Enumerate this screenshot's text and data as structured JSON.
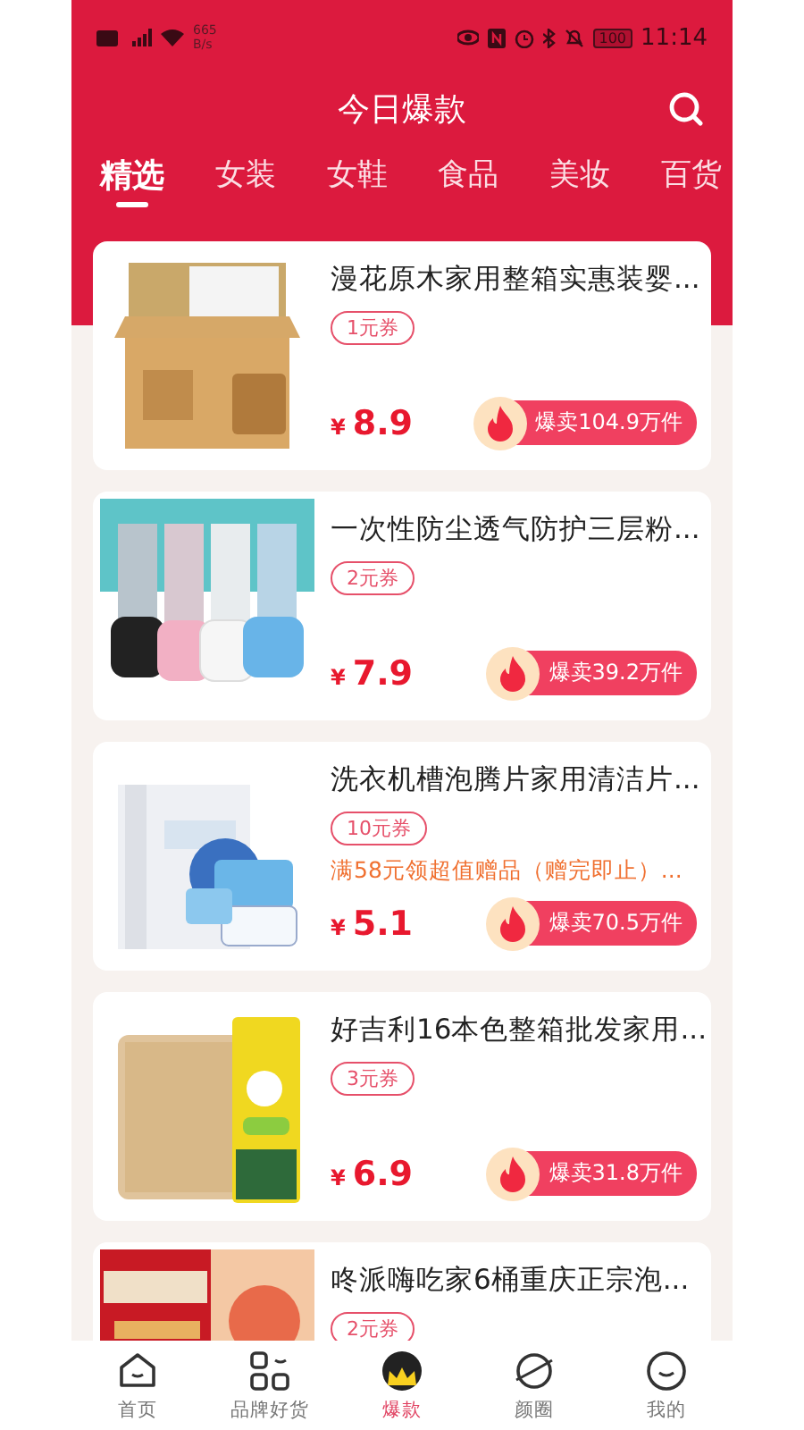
{
  "status_bar": {
    "network_speed": "665 B/s",
    "battery": "100",
    "time": "11:14"
  },
  "header": {
    "title": "今日爆款"
  },
  "tabs": [
    {
      "label": "精选",
      "selected": true
    },
    {
      "label": "女装",
      "selected": false
    },
    {
      "label": "女鞋",
      "selected": false
    },
    {
      "label": "食品",
      "selected": false
    },
    {
      "label": "美妆",
      "selected": false
    },
    {
      "label": "百货",
      "selected": false
    }
  ],
  "products": [
    {
      "kind": "picture",
      "title": "漫花原木家用整箱实惠装婴...",
      "coupon": "1元券",
      "currency": "¥",
      "price": "8.9",
      "sales": "爆卖104.9万件"
    },
    {
      "kind": "picture",
      "title": "一次性防尘透气防护三层粉...",
      "coupon": "2元券",
      "currency": "¥",
      "price": "7.9",
      "sales": "爆卖39.2万件"
    },
    {
      "kind": "picture",
      "title": "洗衣机槽泡腾片家用清洁片...",
      "coupon": "10元券",
      "promo": "满58元领超值赠品（赠完即止）...",
      "currency": "¥",
      "price": "5.1",
      "sales": "爆卖70.5万件"
    },
    {
      "kind": "picture",
      "title": "好吉利16本色整箱批发家用...",
      "coupon": "3元券",
      "currency": "¥",
      "price": "6.9",
      "sales": "爆卖31.8万件"
    },
    {
      "kind": "picture",
      "title": "咚派嗨吃家6桶重庆正宗泡...",
      "coupon": "2元券"
    }
  ],
  "bottom_nav": [
    {
      "label": "首页",
      "selected": false
    },
    {
      "label": "品牌好货",
      "selected": false
    },
    {
      "label": "爆款",
      "selected": true
    },
    {
      "label": "颜圈",
      "selected": false
    },
    {
      "label": "我的",
      "selected": false
    }
  ]
}
